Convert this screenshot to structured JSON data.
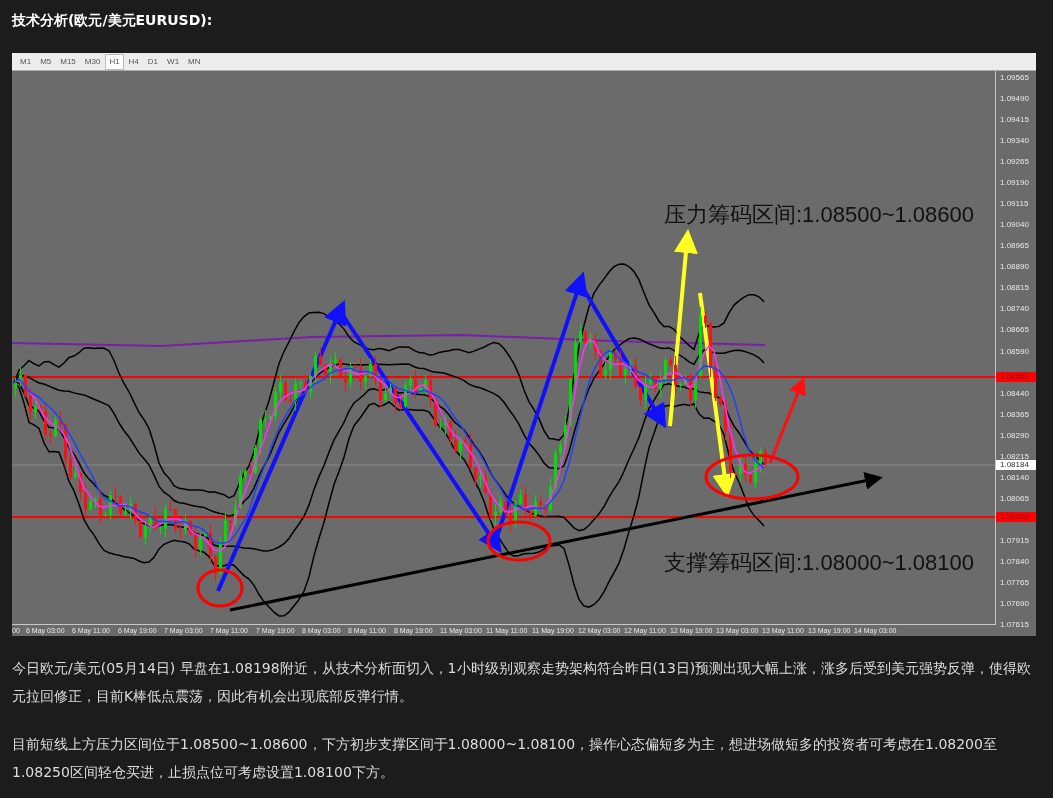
{
  "title": "技术分析(欧元/美元EURUSD):",
  "chart": {
    "timeframes": [
      {
        "label": "M1",
        "selected": false
      },
      {
        "label": "M5",
        "selected": false
      },
      {
        "label": "M15",
        "selected": false
      },
      {
        "label": "M30",
        "selected": false
      },
      {
        "label": "H1",
        "selected": true
      },
      {
        "label": "H4",
        "selected": false
      },
      {
        "label": "D1",
        "selected": false
      },
      {
        "label": "W1",
        "selected": false
      },
      {
        "label": "MN",
        "selected": false
      }
    ],
    "price_axis": [
      "1.09565",
      "1.09490",
      "1.09415",
      "1.09340",
      "1.09265",
      "1.09190",
      "1.09115",
      "1.09040",
      "1.08965",
      "1.08890",
      "1.08815",
      "1.08740",
      "1.08665",
      "1.08590",
      "1.08440",
      "1.08365",
      "1.08290",
      "1.08215",
      "1.08140",
      "1.08065",
      "1.07915",
      "1.07840",
      "1.07765",
      "1.07690",
      "1.07615"
    ],
    "price_badges": [
      {
        "label": "1.08500",
        "kind": "level"
      },
      {
        "label": "1.08184",
        "kind": "current"
      },
      {
        "label": "1.08000",
        "kind": "level"
      }
    ],
    "time_axis": [
      "00",
      "6 May 03:00",
      "6 May 11:00",
      "6 May 19:00",
      "7 May 03:00",
      "7 May 11:00",
      "7 May 19:00",
      "8 May 03:00",
      "8 May 11:00",
      "8 May 19:00",
      "11 May 03:00",
      "11 May 11:00",
      "11 May 19:00",
      "12 May 03:00",
      "12 May 11:00",
      "12 May 19:00",
      "13 May 03:00",
      "13 May 11:00",
      "13 May 19:00",
      "14 May 03:00"
    ],
    "annotations": [
      {
        "text": "压力筹码区间:1.08500~1.08600",
        "kind": "resistance"
      },
      {
        "text": "支撑筹码区间:1.08000~1.08100",
        "kind": "support"
      }
    ]
  },
  "paragraphs": [
    "今日欧元/美元(05月14日) 早盘在1.08198附近，从技术分析面切入，1小时级别观察走势架构符合昨日(13日)预测出现大幅上涨，涨多后受到美元强势反弹，使得欧元拉回修正，目前K棒低点震荡，因此有机会出现底部反弹行情。",
    "目前短线上方压力区间位于1.08500~1.08600，下方初步支撑区间于1.08000~1.08100，操作心态偏短多为主，想进场做短多的投资者可考虑在1.08200至1.08250区间轻仓买进，止损点位可考虑设置1.08100下方。"
  ]
}
